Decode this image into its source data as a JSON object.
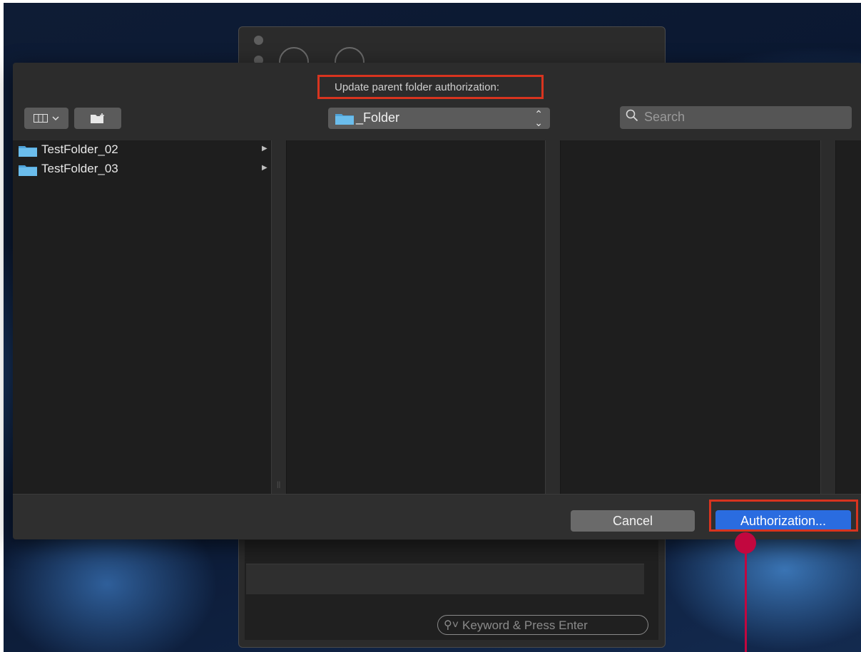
{
  "dialog": {
    "title": "Update parent folder authorization:",
    "path_popup": {
      "label": "_Folder"
    },
    "search": {
      "placeholder": "Search"
    },
    "toolbar": {
      "view_button_label": "≣",
      "new_folder_button_icon": "new-folder-icon"
    },
    "files": [
      {
        "name": "TestFolder_02",
        "icon": "folder-icon",
        "has_children": true
      },
      {
        "name": "TestFolder_03",
        "icon": "folder-icon",
        "has_children": true
      }
    ],
    "buttons": {
      "cancel": "Cancel",
      "authorize": "Authorization..."
    }
  },
  "background_window": {
    "search_placeholder": "Keyword & Press Enter"
  },
  "colors": {
    "accent": "#2a6ce0",
    "highlight": "#d8341f",
    "callout": "#c2073f"
  }
}
